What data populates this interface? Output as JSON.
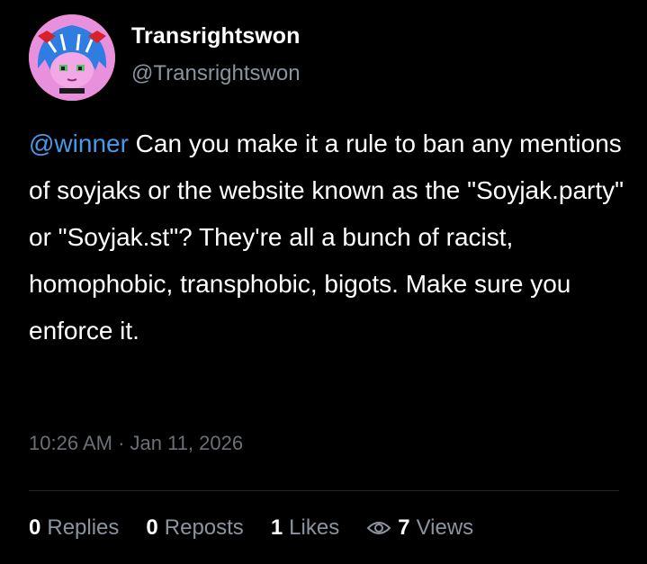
{
  "author": {
    "display_name": "Transrightswon",
    "handle": "@Transrightswon"
  },
  "post": {
    "mention": "@winner",
    "text": " Can you make it a rule to ban any mentions of soyjaks or the website known as the \"Soyjak.party\" or \"Soyjak.st\"? They're all a bunch of racist, homophobic, transphobic, bigots. Make sure you enforce it.",
    "timestamp": "10:26 AM · Jan 11, 2026"
  },
  "stats": {
    "replies": {
      "count": "0",
      "label": "Replies"
    },
    "reposts": {
      "count": "0",
      "label": "Reposts"
    },
    "likes": {
      "count": "1",
      "label": "Likes"
    },
    "views": {
      "count": "7",
      "label": "Views",
      "icon": "eye-icon"
    }
  },
  "colors": {
    "background": "#000000",
    "mention": "#4a99e9",
    "secondary_text": "#8b949e"
  }
}
